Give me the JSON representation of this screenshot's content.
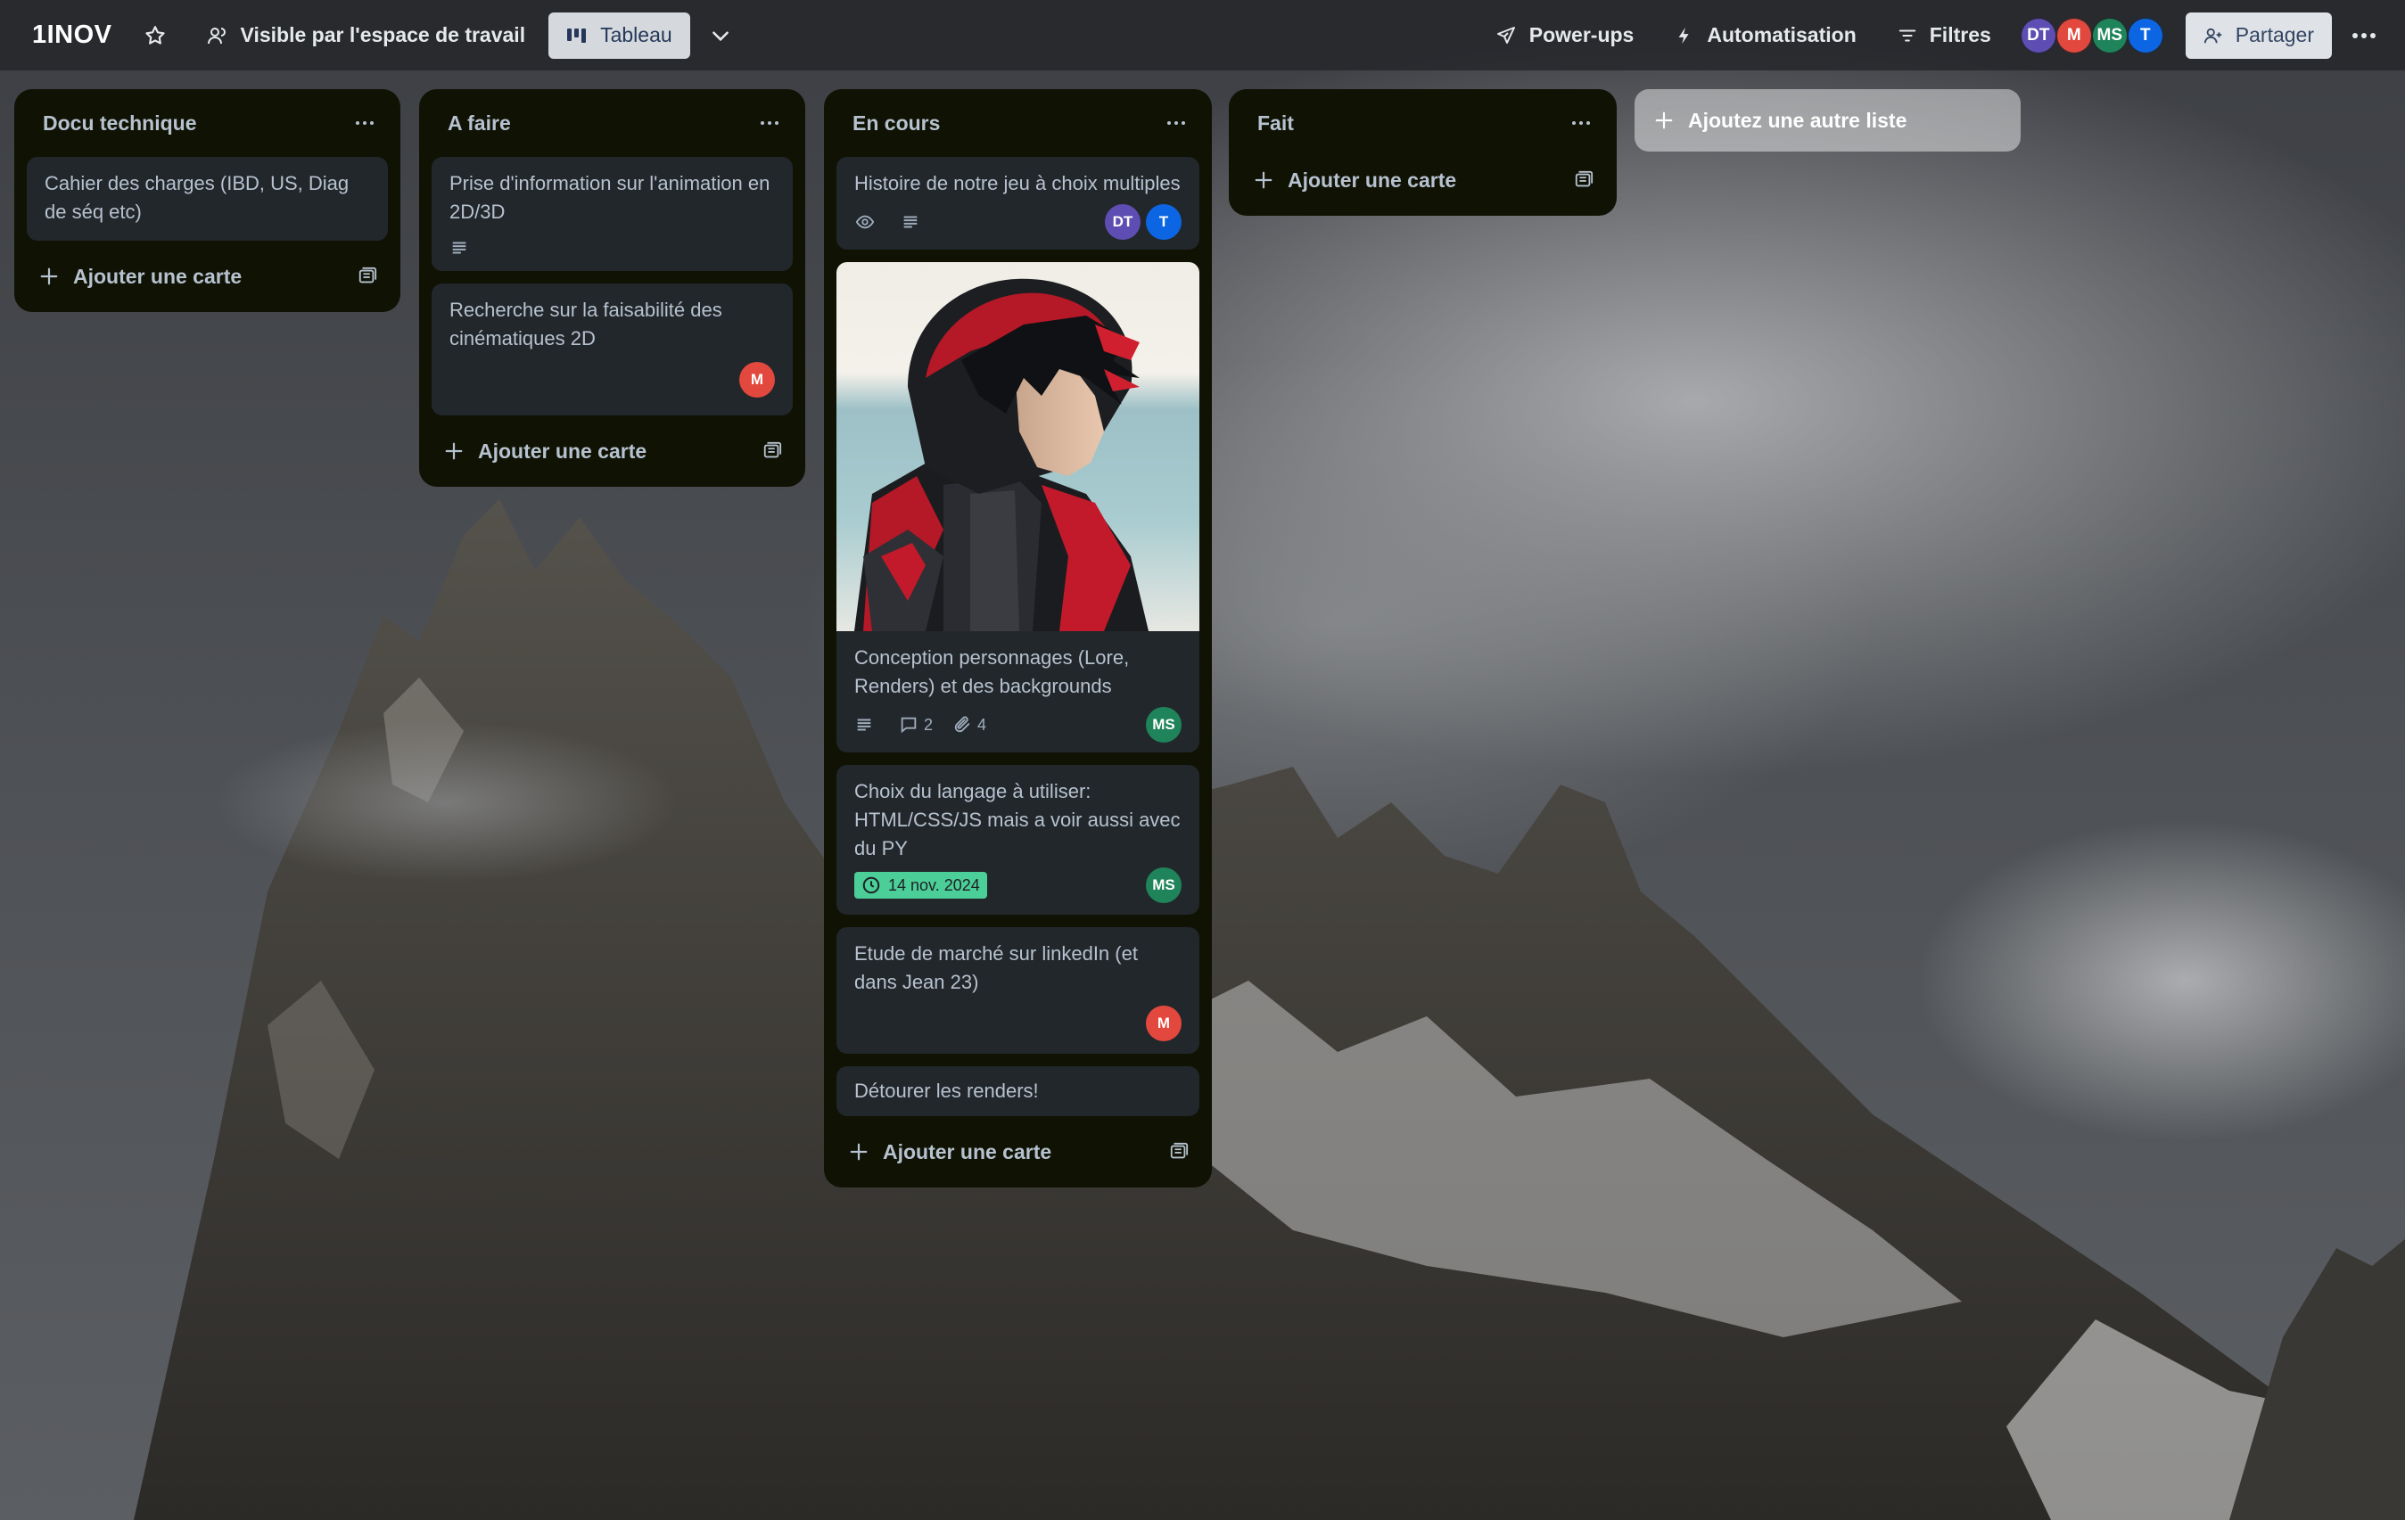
{
  "header": {
    "board_name": "1INOV",
    "visibility_label": "Visible par l'espace de travail",
    "view_label": "Tableau",
    "powerups_label": "Power-ups",
    "automation_label": "Automatisation",
    "filters_label": "Filtres",
    "share_label": "Partager",
    "members": [
      {
        "initials": "DT",
        "color": "#5e4db2"
      },
      {
        "initials": "M",
        "color": "#e2483d"
      },
      {
        "initials": "MS",
        "color": "#1f845a"
      },
      {
        "initials": "T",
        "color": "#0c66e4"
      }
    ]
  },
  "lists": [
    {
      "title": "Docu technique",
      "add_card_label": "Ajouter une carte",
      "cards": [
        {
          "title": "Cahier des charges (IBD, US, Diag de séq etc)"
        }
      ]
    },
    {
      "title": "A faire",
      "add_card_label": "Ajouter une carte",
      "cards": [
        {
          "title": "Prise d'information sur l'animation en 2D/3D",
          "icons": [
            "description-icon"
          ]
        },
        {
          "title": "Recherche sur la faisabilité des cinématiques 2D",
          "members": [
            "M"
          ]
        }
      ]
    },
    {
      "title": "En cours",
      "add_card_label": "Ajouter une carte",
      "cards": [
        {
          "title": "Histoire de notre jeu à choix multiples",
          "icons": [
            "watch-icon",
            "description-icon"
          ],
          "members": [
            "DT",
            "T"
          ]
        },
        {
          "title": "Conception personnages (Lore, Renders) et des backgrounds",
          "has_cover": true,
          "comments": "2",
          "attachments": "4",
          "members": [
            "MS"
          ]
        },
        {
          "title": "Choix du langage à utiliser: HTML/CSS/JS mais a voir aussi avec du PY",
          "due": "14 nov. 2024",
          "due_color": "#4bce97",
          "members": [
            "MS"
          ]
        },
        {
          "title": "Etude de marché sur linkedIn (et dans Jean 23)",
          "members": [
            "M"
          ]
        },
        {
          "title": "Détourer les renders!"
        }
      ]
    },
    {
      "title": "Fait",
      "add_card_label": "Ajouter une carte",
      "cards": []
    }
  ],
  "add_list_label": "Ajoutez une autre liste"
}
